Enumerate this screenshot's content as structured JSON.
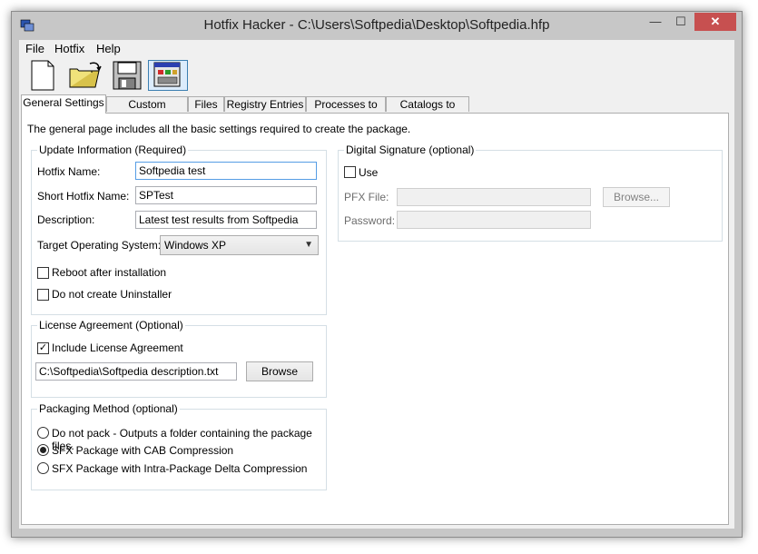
{
  "window": {
    "title": "Hotfix Hacker - C:\\Users\\Softpedia\\Desktop\\Softpedia.hfp",
    "close_symbol": "✕",
    "min_symbol": "—",
    "max_symbol": "☐"
  },
  "menu": {
    "items": [
      "File",
      "Hotfix",
      "Help"
    ]
  },
  "toolbar": {
    "icons": [
      "new-file-icon",
      "open-folder-icon",
      "save-disk-icon",
      "build-package-icon"
    ]
  },
  "tabs": [
    "General Settings",
    "Custom Sections",
    "Files",
    "Registry Entries",
    "Processes to run",
    "Catalogs to Install"
  ],
  "general": {
    "description": "The general page includes all the basic settings required to create the package.",
    "update_info": {
      "title": "Update Information (Required)",
      "hotfix_name_label": "Hotfix Name:",
      "hotfix_name_value": "Softpedia test",
      "short_name_label": "Short Hotfix Name:",
      "short_name_value": "SPTest",
      "description_label": "Description:",
      "description_value": "Latest test results from Softpedia",
      "target_os_label": "Target Operating System:",
      "target_os_value": "Windows XP",
      "reboot_label": "Reboot after installation",
      "reboot_checked": false,
      "no_uninstaller_label": "Do not create Uninstaller",
      "no_uninstaller_checked": false
    },
    "license": {
      "title": "License Agreement (Optional)",
      "include_label": "Include License Agreement",
      "include_checked": true,
      "path_value": "C:\\Softpedia\\Softpedia description.txt",
      "browse_label": "Browse"
    },
    "packaging": {
      "title": "Packaging Method (optional)",
      "options": [
        "Do not pack - Outputs a folder containing the package files.",
        "SFX Package with CAB Compression",
        "SFX Package with Intra-Package Delta Compression"
      ],
      "selected": "SFX Package with CAB Compression"
    },
    "signature": {
      "title": "Digital Signature (optional)",
      "use_label": "Use",
      "use_checked": false,
      "pfx_label": "PFX File:",
      "pfx_value": "",
      "password_label": "Password:",
      "password_value": "",
      "browse_label": "Browse..."
    }
  }
}
